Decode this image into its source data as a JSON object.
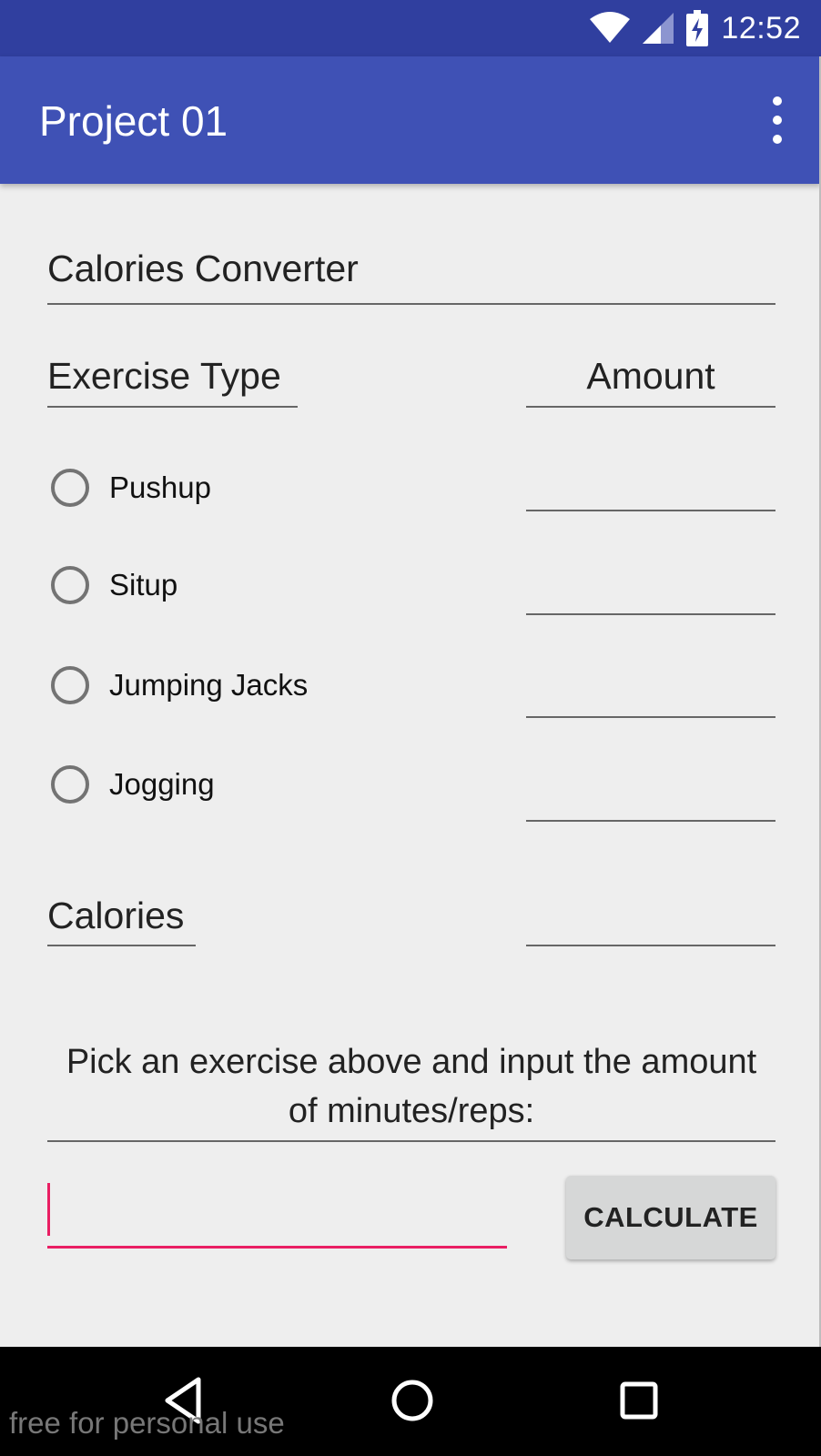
{
  "status_bar": {
    "time": "12:52"
  },
  "app_bar": {
    "title": "Project 01"
  },
  "form": {
    "heading": "Calories Converter",
    "exercise_type_label": "Exercise Type",
    "amount_label": "Amount",
    "exercises": [
      {
        "label": "Pushup",
        "selected": false,
        "amount": ""
      },
      {
        "label": "Situp",
        "selected": false,
        "amount": ""
      },
      {
        "label": "Jumping Jacks",
        "selected": false,
        "amount": ""
      },
      {
        "label": "Jogging",
        "selected": false,
        "amount": ""
      }
    ],
    "calories_label": "Calories",
    "calories_value": "",
    "instruction": "Pick an exercise above and input the amount of minutes/reps:",
    "input_value": "",
    "calculate_label": "CALCULATE"
  },
  "colors": {
    "status_bar": "#303f9f",
    "app_bar": "#3f51b5",
    "accent": "#e91e63",
    "background": "#eeeeee"
  },
  "icons": [
    "wifi-icon",
    "cellular-signal-icon",
    "battery-charging-icon",
    "overflow-menu-icon",
    "back-icon",
    "home-icon",
    "recents-icon"
  ],
  "watermark": "free for personal use"
}
